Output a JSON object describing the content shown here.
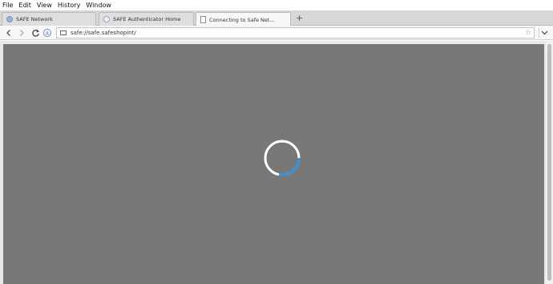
{
  "menubar": {
    "items": [
      "File",
      "Edit",
      "View",
      "History",
      "Window"
    ]
  },
  "tabs": [
    {
      "label": "SAFE Network",
      "icon": "globe-icon"
    },
    {
      "label": "SAFE Authenticator Home",
      "icon": "safe-app-icon"
    },
    {
      "label": "Connecting to Safe Net...",
      "icon": "document-icon"
    }
  ],
  "toolbar": {
    "new_tab_label": "+"
  },
  "address_bar": {
    "url": "safe://safe.safeshopint/"
  },
  "colors": {
    "accent": "#3a8fd8",
    "viewport": "#787878"
  },
  "loading": {
    "progress": 0.28
  }
}
